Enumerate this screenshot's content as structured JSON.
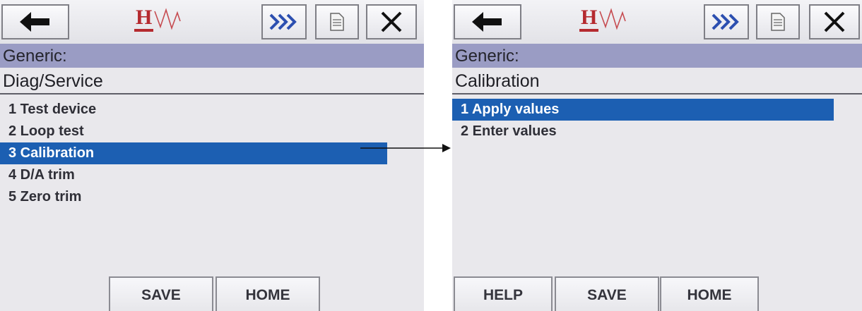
{
  "screens": [
    {
      "section": "Generic:",
      "title": "Diag/Service",
      "items": [
        {
          "label": "1 Test device"
        },
        {
          "label": "2 Loop test"
        },
        {
          "label": "3 Calibration"
        },
        {
          "label": "4 D/A trim"
        },
        {
          "label": "5 Zero trim"
        }
      ],
      "selected_index": 2,
      "footer": {
        "save": "SAVE",
        "home": "HOME"
      }
    },
    {
      "section": "Generic:",
      "title": "Calibration",
      "items": [
        {
          "label": "1 Apply values"
        },
        {
          "label": "2 Enter values"
        }
      ],
      "selected_index": 0,
      "footer": {
        "help": "HELP",
        "save": "SAVE",
        "home": "HOME"
      }
    }
  ],
  "toolbar_icons": [
    "back-arrow-icon",
    "hart-logo-icon",
    "forward-chevrons-icon",
    "document-icon",
    "close-icon"
  ],
  "colors": {
    "section_bar": "#9a9cc4",
    "selection": "#1c5fb2",
    "logo": "#b52a2f",
    "forward_chevrons": "#2c4fb0"
  }
}
